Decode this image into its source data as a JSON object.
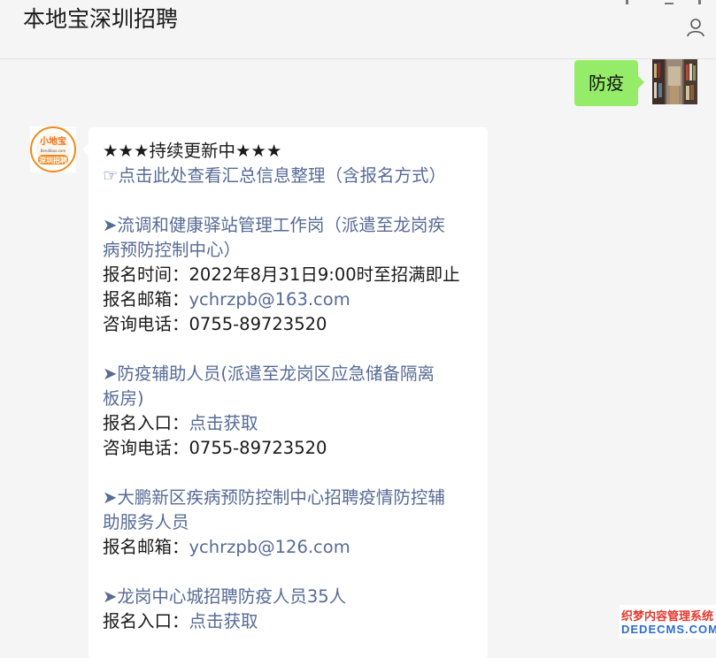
{
  "header": {
    "title": "本地宝深圳招聘"
  },
  "user_message": {
    "text": "防疫"
  },
  "bot_avatar": {
    "top_text": "小地宝",
    "mid_text": "Bendibao.com",
    "bottom_text": "深圳招聘"
  },
  "bot_message": {
    "line1": "★★★持续更新中★★★",
    "line2": "☞点击此处查看汇总信息整理（含报名方式）",
    "s1_title_a": "➤流调和健康驿站管理工作岗（派遣至龙岗疾",
    "s1_title_b": "病预防控制中心）",
    "s1_time": "报名时间：2022年8月31日9:00时至招满即止",
    "s1_email_label": "报名邮箱：",
    "s1_email": "ychrzpb@163.com",
    "s1_phone": "咨询电话：0755-89723520",
    "s2_title_a": "➤防疫辅助人员(派遣至龙岗区应急储备隔离",
    "s2_title_b": "板房)",
    "s2_entry_label": "报名入口：",
    "s2_entry_link": "点击获取",
    "s2_phone": "咨询电话：0755-89723520",
    "s3_title_a": "➤大鹏新区疾病预防控制中心招聘疫情防控辅",
    "s3_title_b": "助服务人员",
    "s3_email_label": "报名邮箱：",
    "s3_email": "ychrzpb@126.com",
    "s4_title": "➤龙岗中心城招聘防疫人员35人",
    "s4_entry_label": "报名入口：",
    "s4_entry_link": "点击获取"
  },
  "watermark": {
    "line1": "织梦内容管理系统",
    "line2": "DEDECMS.COM"
  },
  "colors": {
    "link": "#576b95",
    "user_bubble": "#95ec69",
    "bot_bubble": "#ffffff",
    "background": "#f5f5f5"
  }
}
